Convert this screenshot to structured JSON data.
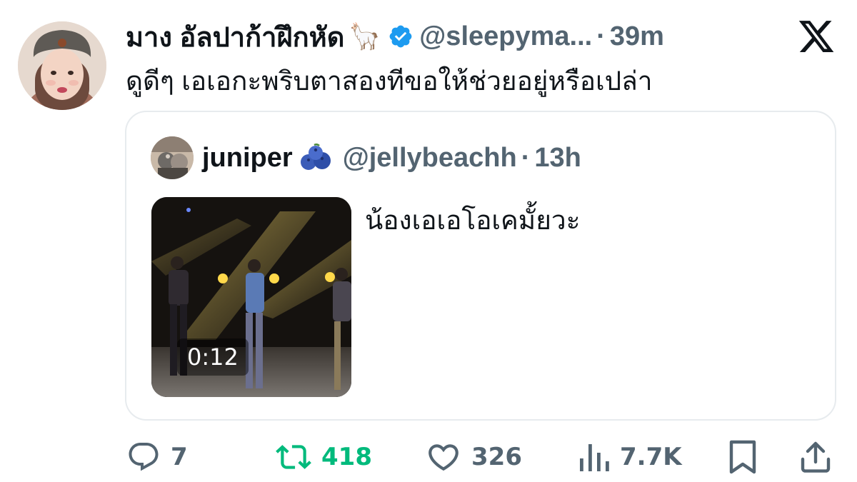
{
  "tweet": {
    "display_name": "มาง อัลปาก้าฝึกหัด",
    "name_emoji": "🦙",
    "handle": "@sleepyma...",
    "separator": "·",
    "time": "39m",
    "text": "ดูดีๆ เอเอกะพริบตาสองทีขอให้ช่วยอยู่หรือเปล่า"
  },
  "quote": {
    "display_name": "juniper",
    "handle": "@jellybeachh",
    "separator": "·",
    "time": "13h",
    "text": "น้องเอเอโอเคมั้ยวะ",
    "video_duration": "0:12"
  },
  "actions": {
    "replies": "7",
    "reposts": "418",
    "likes": "326",
    "views": "7.7K"
  },
  "colors": {
    "text": "#0f1419",
    "secondary": "#536471",
    "verified": "#1d9bf0",
    "repost": "#00ba7c",
    "border": "#e7ebee"
  },
  "icons": {
    "verified": "verified-badge-icon",
    "logo": "x-logo-icon",
    "reply": "reply-icon",
    "repost": "repost-icon",
    "like": "heart-icon",
    "views": "views-chart-icon",
    "bookmark": "bookmark-icon",
    "share": "share-icon"
  }
}
